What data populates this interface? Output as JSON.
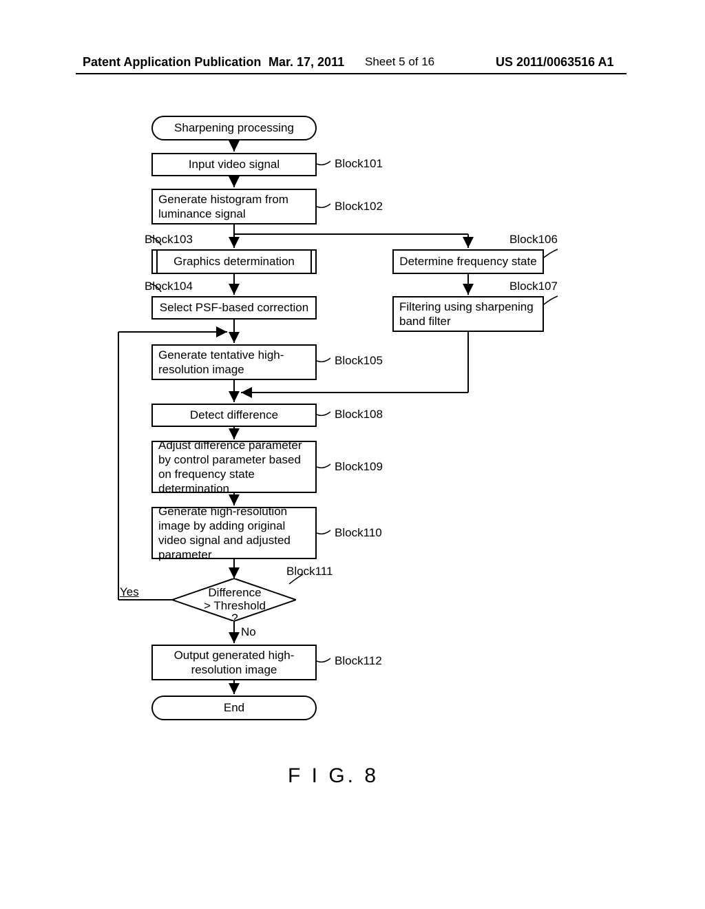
{
  "header": {
    "left": "Patent Application Publication",
    "date": "Mar. 17, 2011",
    "sheet": "Sheet 5 of 16",
    "pubno": "US 2011/0063516 A1"
  },
  "flow": {
    "start": "Sharpening processing",
    "b101": "Input video signal",
    "b102": "Generate histogram from luminance signal",
    "b103": "Graphics determination",
    "b104": "Select PSF-based correction",
    "b105": "Generate tentative high-resolution image",
    "b106": "Determine frequency state",
    "b107": "Filtering using sharpening band filter",
    "b108": "Detect difference",
    "b109": "Adjust difference parameter by control parameter based on frequency state determination",
    "b110": "Generate high-resolution image by adding original video signal and adjusted parameter",
    "b111": "Difference > Threshold ?",
    "b112": "Output generated high-resolution image",
    "end": "End",
    "yes": "Yes",
    "no": "No"
  },
  "labels": {
    "l101": "Block101",
    "l102": "Block102",
    "l103": "Block103",
    "l104": "Block104",
    "l105": "Block105",
    "l106": "Block106",
    "l107": "Block107",
    "l108": "Block108",
    "l109": "Block109",
    "l110": "Block110",
    "l111": "Block111",
    "l112": "Block112"
  },
  "figure": "F I G. 8"
}
